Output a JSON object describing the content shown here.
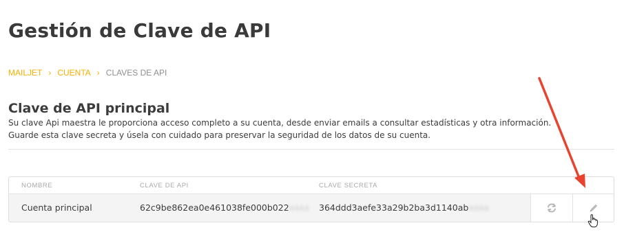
{
  "page": {
    "title": "Gestión de Clave de API"
  },
  "breadcrumb": {
    "items": [
      "MAILJET",
      "CUENTA",
      "CLAVES DE API"
    ],
    "separator": "›"
  },
  "section": {
    "title": "Clave de API principal",
    "line1": "Su clave Api maestra le proporciona acceso completo a su cuenta, desde enviar emails a consultar estadísticas y otra información.",
    "line2": "Guarde esta clave secreta y úsela con cuidado para preservar la seguridad de los datos de su cuenta."
  },
  "table": {
    "headers": {
      "name": "NOMBRE",
      "api_key": "CLAVE DE API",
      "secret_key": "CLAVE SECRETA"
    },
    "row": {
      "name": "Cuenta principal",
      "api_key_visible": "62c9be862ea0e461038fe000b022",
      "api_key_hidden": "xxxx",
      "secret_key_visible": "364ddd3aefe33a29b2ba3d1140ab",
      "secret_key_hidden": "xxxx"
    },
    "actions": [
      "regenerate-icon",
      "edit-icon"
    ]
  },
  "colors": {
    "accent": "#f6b000",
    "arrow": "#e8432e",
    "text": "#3c3c3c",
    "muted": "#a8a8a8"
  }
}
